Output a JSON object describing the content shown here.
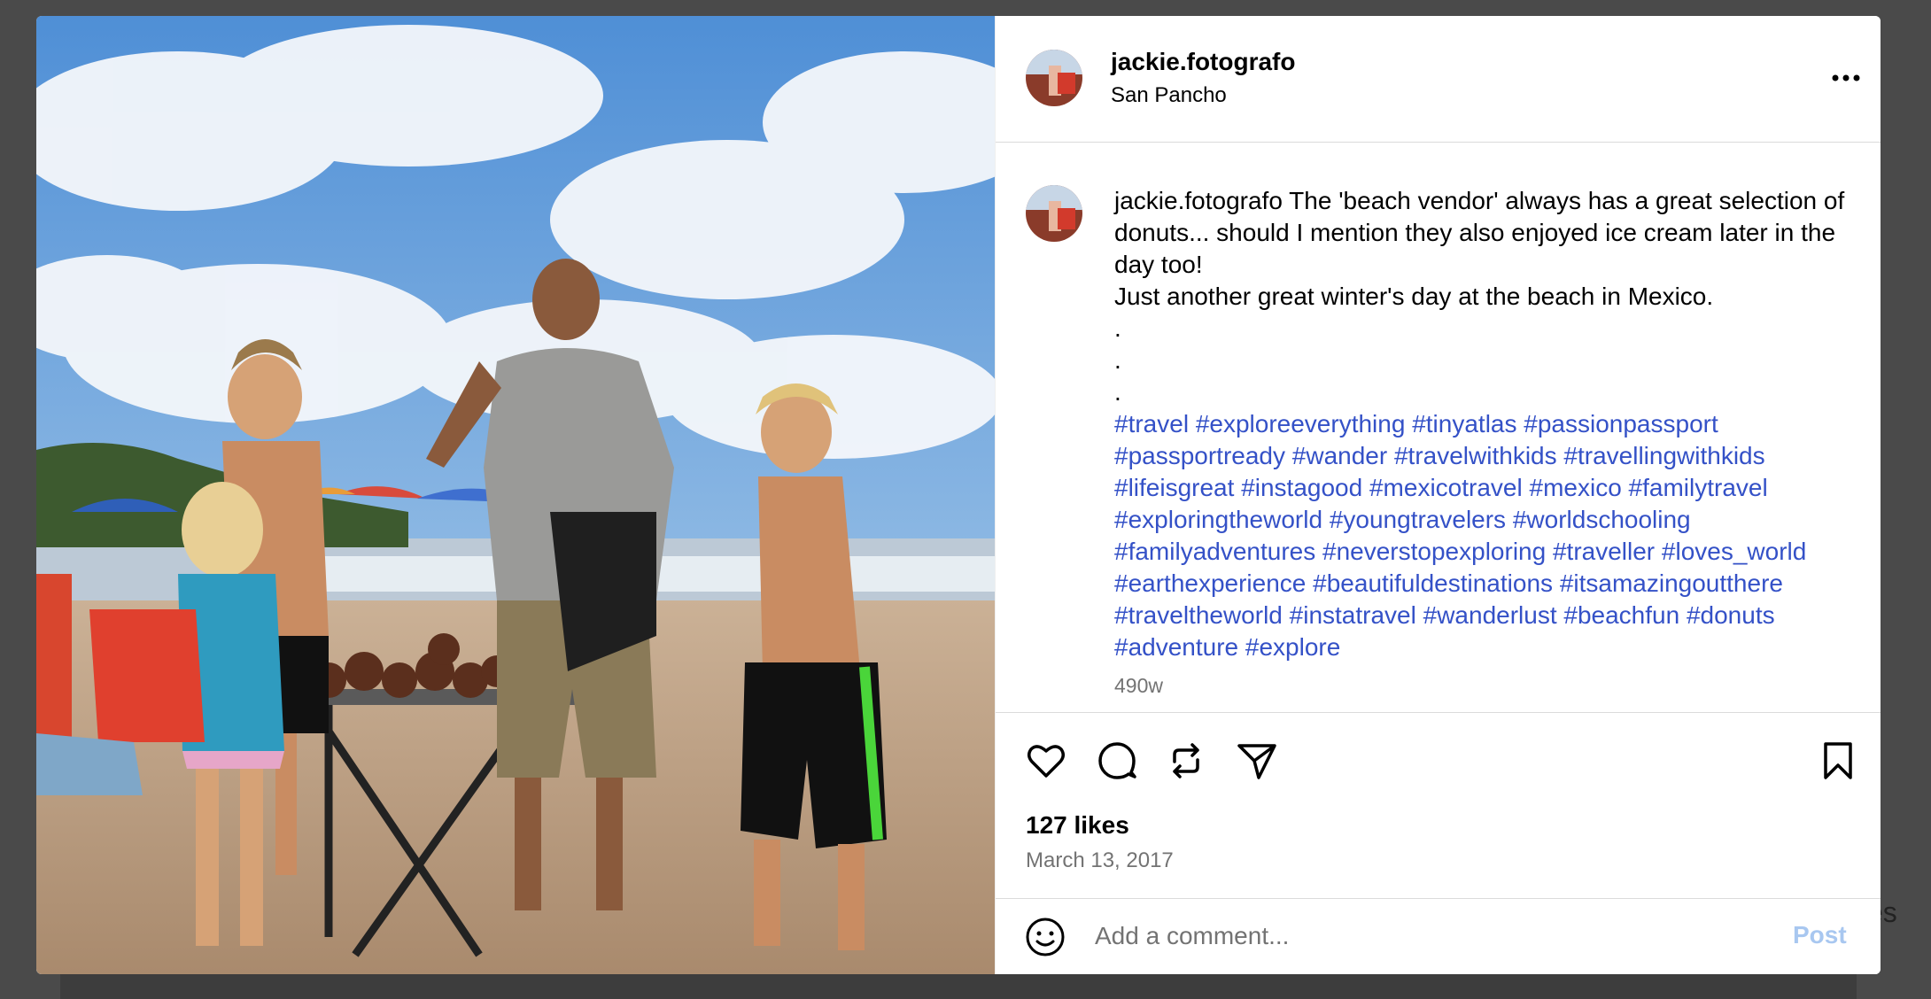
{
  "post": {
    "username": "jackie.fotografo",
    "location": "San Pancho",
    "caption_lines": [
      "The 'beach vendor' always has a great selection of donuts... should I mention they also enjoyed ice cream later in the day too!",
      "Just another great winter's day at the beach in Mexico.",
      ".",
      ".",
      "."
    ],
    "hashtags": [
      "#travel",
      "#exploreeverything",
      "#tinyatlas",
      "#passionpassport",
      "#passportready",
      "#wander",
      "#travelwithkids",
      "#travellingwithkids",
      "#lifeisgreat",
      "#instagood",
      "#mexicotravel",
      "#mexico",
      "#familytravel",
      "#exploringtheworld",
      "#youngtravelers",
      "#worldschooling",
      "#familyadventures",
      "#neverstopexploring",
      "#traveller",
      "#loves_world",
      "#earthexperience",
      "#beautifuldestinations",
      "#itsamazingoutthere",
      "#traveltheworld",
      "#instatravel",
      "#wanderlust",
      "#beachfun",
      "#donuts",
      "#adventure",
      "#explore"
    ],
    "age": "490w",
    "likes": "127 likes",
    "date": "March 13, 2017"
  },
  "comment": {
    "placeholder": "Add a comment...",
    "post_label": "Post"
  },
  "icons": {
    "more": "more-options-icon",
    "like": "heart-icon",
    "comment": "comment-icon",
    "repost": "repost-icon",
    "share": "share-icon",
    "save": "bookmark-icon",
    "emoji": "emoji-icon"
  },
  "colors": {
    "hashtag": "#3451c7",
    "muted": "#737373",
    "post_button": "#a8c7f0"
  }
}
